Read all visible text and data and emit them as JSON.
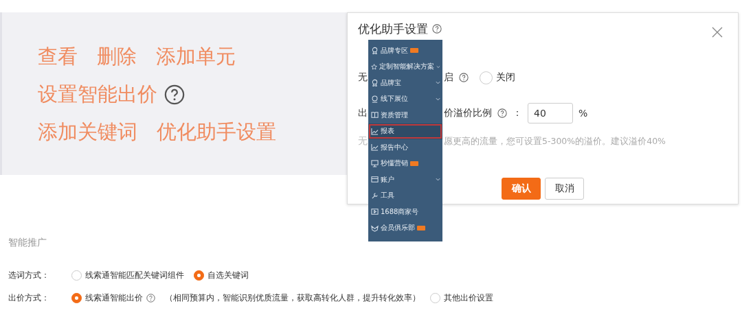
{
  "actions_panel": {
    "lines": [
      {
        "items": [
          {
            "label": "查看",
            "help": false
          },
          {
            "label": "删除",
            "help": false
          },
          {
            "label": "添加单元",
            "help": false
          }
        ]
      },
      {
        "items": [
          {
            "label": "设置智能出价",
            "help": true
          }
        ]
      },
      {
        "items": [
          {
            "label": "添加关键词",
            "help": false
          },
          {
            "label": "优化助手设置",
            "help": false
          }
        ]
      }
    ]
  },
  "dialog": {
    "title": "优化助手设置",
    "rows": [
      {
        "kind": "radio",
        "left": "无",
        "right": "启",
        "options": [
          {
            "label": "关闭",
            "selected": false
          }
        ]
      },
      {
        "kind": "input",
        "left": "出",
        "right": "价溢价比例",
        "colon": "：",
        "value": "40",
        "unit": "%"
      },
      {
        "kind": "hint",
        "left": "无",
        "right": "愿更高的流量，您可设置5-300%的溢价。建议溢价40%"
      }
    ],
    "buttons": [
      {
        "label": "确认",
        "kind": "primary"
      },
      {
        "label": "取消",
        "kind": "secondary"
      }
    ]
  },
  "sidebar": {
    "items": [
      {
        "label": "品牌专区",
        "badge": true,
        "expandable": false,
        "selected": false
      },
      {
        "label": "定制智能解决方案",
        "badge": false,
        "expandable": true,
        "selected": false
      },
      {
        "label": "品牌宝",
        "badge": false,
        "expandable": true,
        "selected": false
      },
      {
        "label": "线下展位",
        "badge": false,
        "expandable": true,
        "selected": false
      },
      {
        "label": "资质管理",
        "badge": false,
        "expandable": false,
        "selected": false
      },
      {
        "label": "报表",
        "badge": false,
        "expandable": false,
        "selected": true
      },
      {
        "label": "报告中心",
        "badge": false,
        "expandable": false,
        "selected": false
      },
      {
        "label": "秒懂营销",
        "badge": true,
        "expandable": false,
        "selected": false
      },
      {
        "label": "账户",
        "badge": false,
        "expandable": true,
        "selected": false
      },
      {
        "label": "工具",
        "badge": false,
        "expandable": false,
        "selected": false
      },
      {
        "label": "1688商家号",
        "badge": false,
        "expandable": false,
        "selected": false
      },
      {
        "label": "会员俱乐部",
        "badge": true,
        "expandable": false,
        "selected": false
      }
    ]
  },
  "smart_promotion": {
    "title": "智能推广",
    "rows": [
      {
        "label": "选词方式：",
        "options": [
          {
            "label": "线索通智能匹配关键词组件",
            "selected": false,
            "help": false
          },
          {
            "label": "自选关键词",
            "selected": true,
            "help": false
          }
        ]
      },
      {
        "label": "出价方式：",
        "options": [
          {
            "label": "线索通智能出价",
            "selected": true,
            "help": true,
            "note": "（相同预算内，智能识别优质流量，获取高转化人群，提升转化效率）"
          },
          {
            "label": "其他出价设置",
            "selected": false,
            "help": false
          }
        ]
      }
    ]
  }
}
